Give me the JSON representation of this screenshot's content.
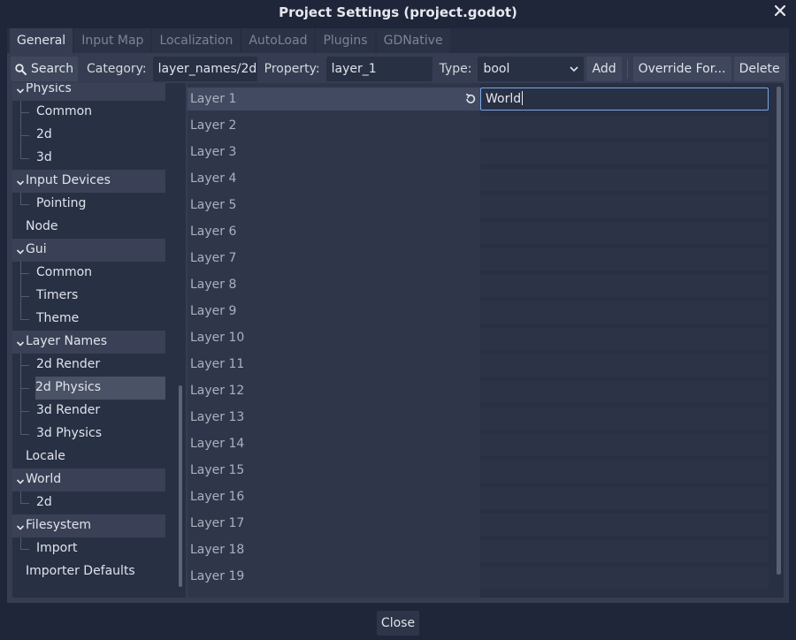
{
  "window": {
    "title": "Project Settings (project.godot)"
  },
  "tabs": [
    "General",
    "Input Map",
    "Localization",
    "AutoLoad",
    "Plugins",
    "GDNative"
  ],
  "toolbar": {
    "search_label": "Search",
    "category_label": "Category:",
    "category_value": "layer_names/2d",
    "property_label": "Property:",
    "property_value": "layer_1",
    "type_label": "Type:",
    "type_value": "bool",
    "add_label": "Add",
    "override_label": "Override For...",
    "delete_label": "Delete"
  },
  "tree": [
    {
      "label": "Physics",
      "level": 0,
      "category": true
    },
    {
      "label": "Common",
      "level": 1
    },
    {
      "label": "2d",
      "level": 1
    },
    {
      "label": "3d",
      "level": 1
    },
    {
      "label": "Input Devices",
      "level": 0,
      "category": true
    },
    {
      "label": "Pointing",
      "level": 1
    },
    {
      "label": "Node",
      "level": 0
    },
    {
      "label": "Gui",
      "level": 0,
      "category": true
    },
    {
      "label": "Common",
      "level": 1
    },
    {
      "label": "Timers",
      "level": 1
    },
    {
      "label": "Theme",
      "level": 1
    },
    {
      "label": "Layer Names",
      "level": 0,
      "category": true
    },
    {
      "label": "2d Render",
      "level": 1
    },
    {
      "label": "2d Physics",
      "level": 1,
      "selected": true
    },
    {
      "label": "3d Render",
      "level": 1
    },
    {
      "label": "3d Physics",
      "level": 1
    },
    {
      "label": "Locale",
      "level": 0
    },
    {
      "label": "World",
      "level": 0,
      "category": true
    },
    {
      "label": "2d",
      "level": 1
    },
    {
      "label": "Filesystem",
      "level": 0,
      "category": true
    },
    {
      "label": "Import",
      "level": 1
    },
    {
      "label": "Importer Defaults",
      "level": 0
    }
  ],
  "properties": [
    {
      "name": "Layer 1",
      "value": "World",
      "selected": true
    },
    {
      "name": "Layer 2",
      "value": ""
    },
    {
      "name": "Layer 3",
      "value": ""
    },
    {
      "name": "Layer 4",
      "value": ""
    },
    {
      "name": "Layer 5",
      "value": ""
    },
    {
      "name": "Layer 6",
      "value": ""
    },
    {
      "name": "Layer 7",
      "value": ""
    },
    {
      "name": "Layer 8",
      "value": ""
    },
    {
      "name": "Layer 9",
      "value": ""
    },
    {
      "name": "Layer 10",
      "value": ""
    },
    {
      "name": "Layer 11",
      "value": ""
    },
    {
      "name": "Layer 12",
      "value": ""
    },
    {
      "name": "Layer 13",
      "value": ""
    },
    {
      "name": "Layer 14",
      "value": ""
    },
    {
      "name": "Layer 15",
      "value": ""
    },
    {
      "name": "Layer 16",
      "value": ""
    },
    {
      "name": "Layer 17",
      "value": ""
    },
    {
      "name": "Layer 18",
      "value": ""
    },
    {
      "name": "Layer 19",
      "value": ""
    }
  ],
  "footer": {
    "close_label": "Close"
  },
  "colors": {
    "accent": "#7aa7e8",
    "background": "#20263a",
    "panel": "#363d52"
  },
  "icons": {
    "close": "close-icon",
    "search": "search-icon",
    "revert": "revert-icon",
    "dropdown": "chevron-down-icon",
    "collapse": "chevron-down-icon"
  }
}
